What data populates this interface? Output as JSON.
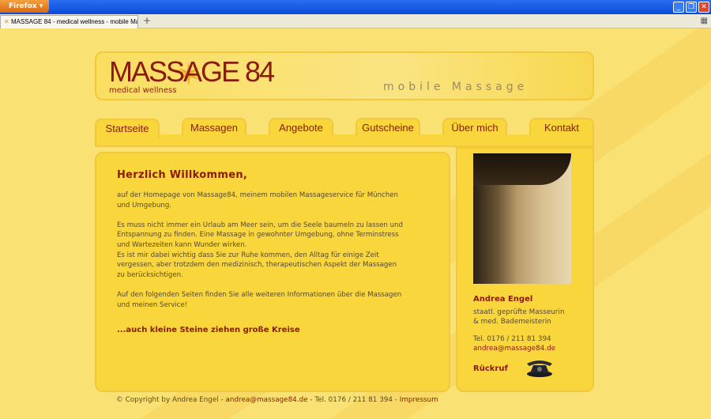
{
  "browser": {
    "menu_button": "Firefox",
    "tab_title": "MASSAGE 84 - medical wellness - mobile Mas...",
    "new_tab": "+"
  },
  "header": {
    "logo": "MASSAGE 84",
    "logo_sub": "medical wellness",
    "slogan": "mobile Massage"
  },
  "nav": [
    {
      "label": "Startseite",
      "active": true
    },
    {
      "label": "Massagen"
    },
    {
      "label": "Angebote"
    },
    {
      "label": "Gutscheine"
    },
    {
      "label": "Über mich"
    },
    {
      "label": "Kontakt"
    }
  ],
  "main": {
    "heading": "Herzlich Willkommen,",
    "p1": [
      "auf der Homepage von Massage84, meinem mobilen Massageservice für München",
      "und Umgebung."
    ],
    "p2": [
      "Es muss nicht immer ein Urlaub am Meer sein, um die Seele baumeln zu lassen und",
      "Entspannung zu finden. Eine Massage in gewohnter Umgebung, ohne Terminstress",
      "und Wartezeiten kann Wunder wirken.",
      "Es ist mir dabei wichtig dass Sie zur Ruhe kommen, den Alltag für einige Zeit",
      "vergessen, aber trotzdem den medizinisch, therapeutischen Aspekt der Massagen",
      "zu berücksichtigen."
    ],
    "p3": [
      "Auf den folgenden Seiten finden Sie alle weiteren Informationen über die Massagen",
      "und meinen Service!"
    ],
    "motto": "...auch kleine Steine ziehen große Kreise"
  },
  "sidebar": {
    "name": "Andrea Engel",
    "title1": "staatl. geprüfte Masseurin",
    "title2": "& med. Bademeisterin",
    "tel": "Tel. 0176 / 211 81 394",
    "email": "andrea@massage84.de",
    "callback": "Rückruf"
  },
  "footer": {
    "copyright": "© Copyright by Andrea Engel - ",
    "email": "andrea@massage84.de",
    "tel": " - Tel. 0176 / 211 81 394 - ",
    "impressum": "Impressum"
  }
}
